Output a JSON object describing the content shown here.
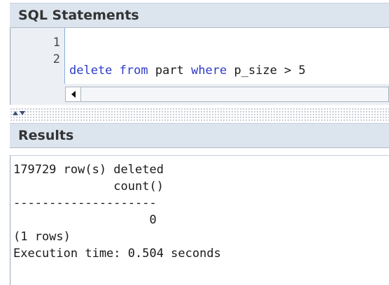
{
  "sql_panel": {
    "title": "SQL Statements",
    "line_numbers": [
      "1",
      "2"
    ],
    "code": {
      "kw_delete": "delete",
      "kw_from": "from",
      "table": "part",
      "kw_where": "where",
      "condition": "p_size > 5"
    }
  },
  "results_panel": {
    "title": "Results",
    "lines": [
      "179729 row(s) deleted",
      "              count()",
      "--------------------",
      "                   0",
      "(1 rows)",
      "Execution time: 0.504 seconds"
    ]
  }
}
